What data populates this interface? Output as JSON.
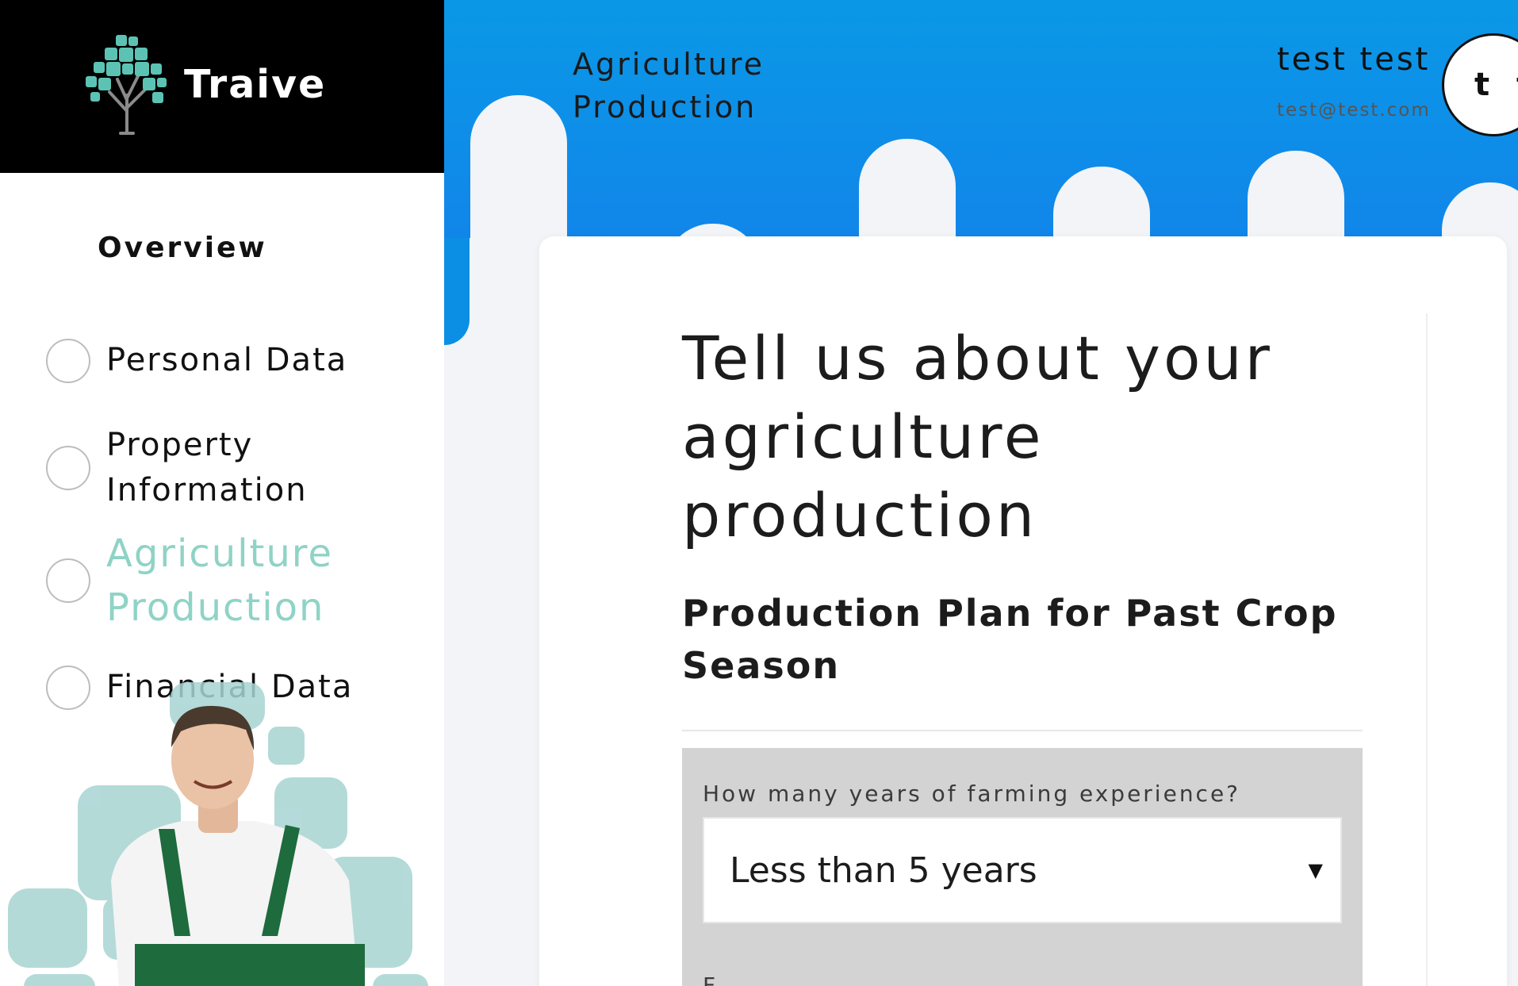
{
  "brand": {
    "name": "Traive"
  },
  "sidebar": {
    "overview_label": "Overview",
    "steps": [
      {
        "label": "Personal Data",
        "active": false
      },
      {
        "label": "Property Information",
        "active": false
      },
      {
        "label": "Agriculture Production",
        "active": true
      },
      {
        "label": "Financial Data",
        "active": false
      }
    ]
  },
  "header": {
    "section_title": "Agriculture Production",
    "user_name": "test test",
    "user_email": "test@test.com",
    "avatar_initials": "t t"
  },
  "main": {
    "heading": "Tell us about your agriculture production",
    "subheading": "Production Plan for Past Crop Season",
    "question": {
      "label": "How many years of farming experience?",
      "selected": "Less than 5 years"
    },
    "next_question_partial": "F"
  },
  "colors": {
    "header_blue": "#0a98e6",
    "active_step": "#8fd3c6",
    "brand_bg": "#000000",
    "question_bg": "#d3d3d3"
  },
  "icons": [
    "tree-logo-icon",
    "step-radio-icon",
    "caret-down-icon",
    "farmer-photo"
  ]
}
